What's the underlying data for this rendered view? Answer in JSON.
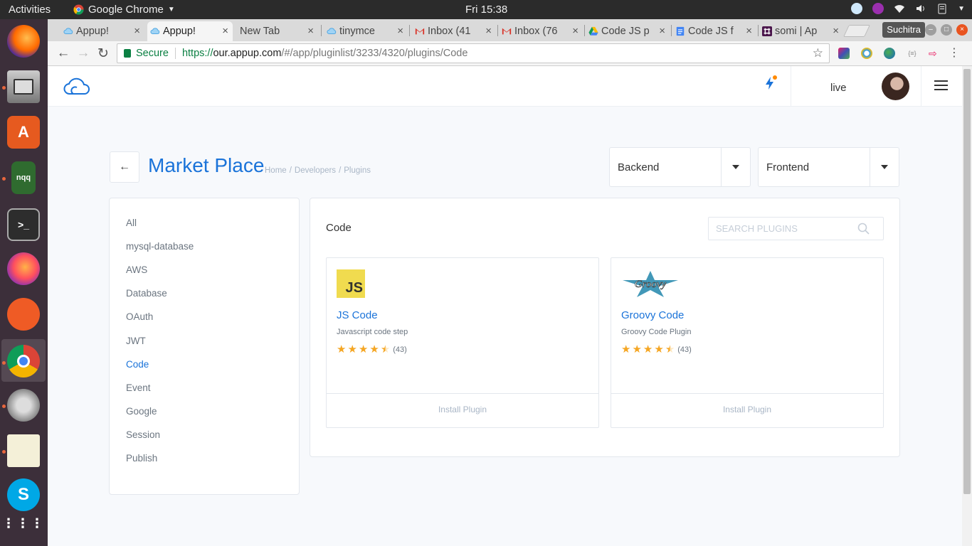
{
  "os": {
    "activities_label": "Activities",
    "app_menu_label": "Google Chrome",
    "clock": "Fri 15:38"
  },
  "browser": {
    "tabs": [
      {
        "label": "Appup!",
        "active": false
      },
      {
        "label": "Appup!",
        "active": true
      },
      {
        "label": "New Tab",
        "active": false
      },
      {
        "label": "tinymce",
        "active": false
      },
      {
        "label": "Inbox (41",
        "active": false
      },
      {
        "label": "Inbox (76",
        "active": false
      },
      {
        "label": "Code JS p",
        "active": false
      },
      {
        "label": "Code JS f",
        "active": false
      },
      {
        "label": "somi | Ap",
        "active": false
      }
    ],
    "profile_name": "Suchitra",
    "address": {
      "secure_label": "Secure",
      "scheme": "https://",
      "host": "our.appup.com",
      "path": "/#/app/pluginlist/3233/4320/plugins/Code"
    }
  },
  "header": {
    "env_label": "live"
  },
  "page": {
    "title": "Market Place",
    "breadcrumb": [
      "Home",
      "/",
      "Developers",
      "/",
      "Plugins"
    ],
    "filters": {
      "backend_label": "Backend",
      "frontend_label": "Frontend"
    },
    "categories": [
      {
        "label": "All",
        "active": false
      },
      {
        "label": "mysql-database",
        "active": false
      },
      {
        "label": "AWS",
        "active": false
      },
      {
        "label": "Database",
        "active": false
      },
      {
        "label": "OAuth",
        "active": false
      },
      {
        "label": "JWT",
        "active": false
      },
      {
        "label": "Code",
        "active": true
      },
      {
        "label": "Event",
        "active": false
      },
      {
        "label": "Google",
        "active": false
      },
      {
        "label": "Session",
        "active": false
      },
      {
        "label": "Publish",
        "active": false
      }
    ],
    "panel_title": "Code",
    "search_placeholder": "SEARCH PLUGINS",
    "plugins": [
      {
        "name": "JS Code",
        "description": "Javascript code step",
        "rating": 4.5,
        "count": "(43)",
        "action": "Install Plugin",
        "logo": "js-logo",
        "logo_text": "JS"
      },
      {
        "name": "Groovy Code",
        "description": "Groovy Code Plugin",
        "rating": 4.5,
        "count": "(43)",
        "action": "Install Plugin",
        "logo": "groovy-logo",
        "logo_text": "Groovy"
      }
    ]
  },
  "colors": {
    "accent": "#1a73d9",
    "star": "#f5a623",
    "secure": "#0b8043"
  }
}
